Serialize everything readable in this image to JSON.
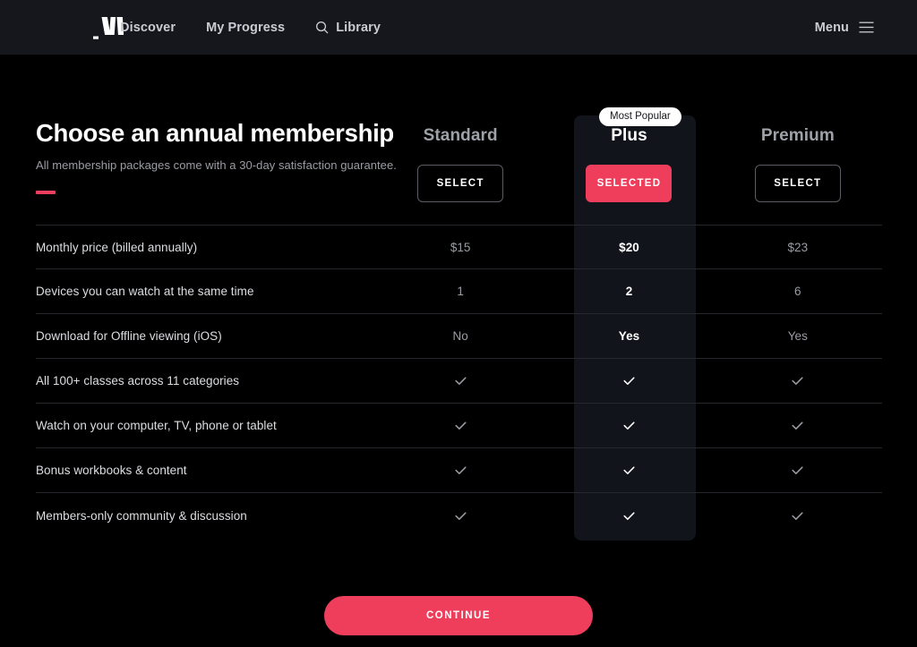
{
  "nav": {
    "logo_name": "masterclass-logo",
    "links": [
      {
        "label": "Discover",
        "icon": null
      },
      {
        "label": "My Progress",
        "icon": null
      },
      {
        "label": "Library",
        "icon": "search-icon"
      }
    ],
    "menu_label": "Menu",
    "menu_icon": "hamburger-icon"
  },
  "header": {
    "title": "Choose an annual membership",
    "subtitle": "All membership packages come with a 30-day satisfaction guarantee.",
    "accent_color": "#ef3e5c"
  },
  "badge": {
    "label": "Most Popular"
  },
  "plans": [
    {
      "name": "Standard",
      "cta": "SELECT",
      "selected": false
    },
    {
      "name": "Plus",
      "cta": "SELECTED",
      "selected": true
    },
    {
      "name": "Premium",
      "cta": "SELECT",
      "selected": false
    }
  ],
  "table": {
    "rows": [
      {
        "label": "Monthly price (billed annually)",
        "values": [
          "$15",
          "$20",
          "$23"
        ],
        "type": "text"
      },
      {
        "label": "Devices you can watch at the same time",
        "values": [
          "1",
          "2",
          "6"
        ],
        "type": "text"
      },
      {
        "label": "Download for Offline viewing (iOS)",
        "values": [
          "No",
          "Yes",
          "Yes"
        ],
        "type": "text"
      },
      {
        "label": "All 100+ classes across 11 categories",
        "values": [
          "check",
          "check",
          "check"
        ],
        "type": "check"
      },
      {
        "label": "Watch on your computer, TV, phone or tablet",
        "values": [
          "check",
          "check",
          "check"
        ],
        "type": "check"
      },
      {
        "label": "Bonus workbooks & content",
        "values": [
          "check",
          "check",
          "check"
        ],
        "type": "check"
      },
      {
        "label": "Members-only community & discussion",
        "values": [
          "check",
          "check",
          "check"
        ],
        "type": "check"
      }
    ]
  },
  "footer": {
    "continue_label": "CONTINUE"
  },
  "colors": {
    "background": "#000000",
    "nav_background": "#15171c",
    "accent": "#ef3e5c",
    "featured_column": "#12141b",
    "divider": "#26282d",
    "text_primary": "#ffffff",
    "text_muted": "#9a9da4"
  }
}
